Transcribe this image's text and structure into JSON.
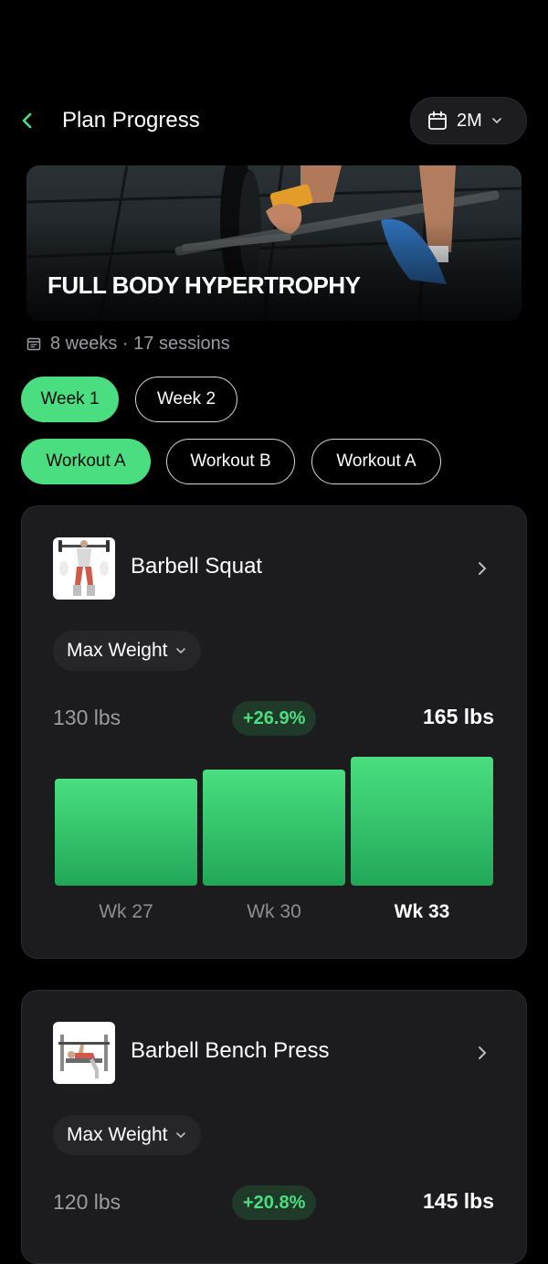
{
  "header": {
    "title": "Plan Progress",
    "range_label": "2M"
  },
  "hero": {
    "title": "FULL BODY HYPERTROPHY"
  },
  "plan_meta": "8 weeks · 17 sessions",
  "week_chips": [
    {
      "label": "Week 1",
      "active": true
    },
    {
      "label": "Week 2",
      "active": false
    }
  ],
  "workout_chips": [
    {
      "label": "Workout A",
      "active": true
    },
    {
      "label": "Workout B",
      "active": false
    },
    {
      "label": "Workout A",
      "active": false
    }
  ],
  "exercises": [
    {
      "name": "Barbell Squat",
      "metric": "Max Weight",
      "start": "130 lbs",
      "change": "+26.9%",
      "end": "165 lbs",
      "chart_data": {
        "type": "bar",
        "categories": [
          "Wk 27",
          "Wk 30",
          "Wk 33"
        ],
        "values": [
          130,
          145,
          165
        ],
        "highlight_category": "Wk 33"
      }
    },
    {
      "name": "Barbell Bench Press",
      "metric": "Max Weight",
      "start": "120 lbs",
      "change": "+20.8%",
      "end": "145 lbs"
    }
  ],
  "colors": {
    "accent": "#4ade80",
    "card": "#1c1c1f",
    "background": "#000000"
  }
}
